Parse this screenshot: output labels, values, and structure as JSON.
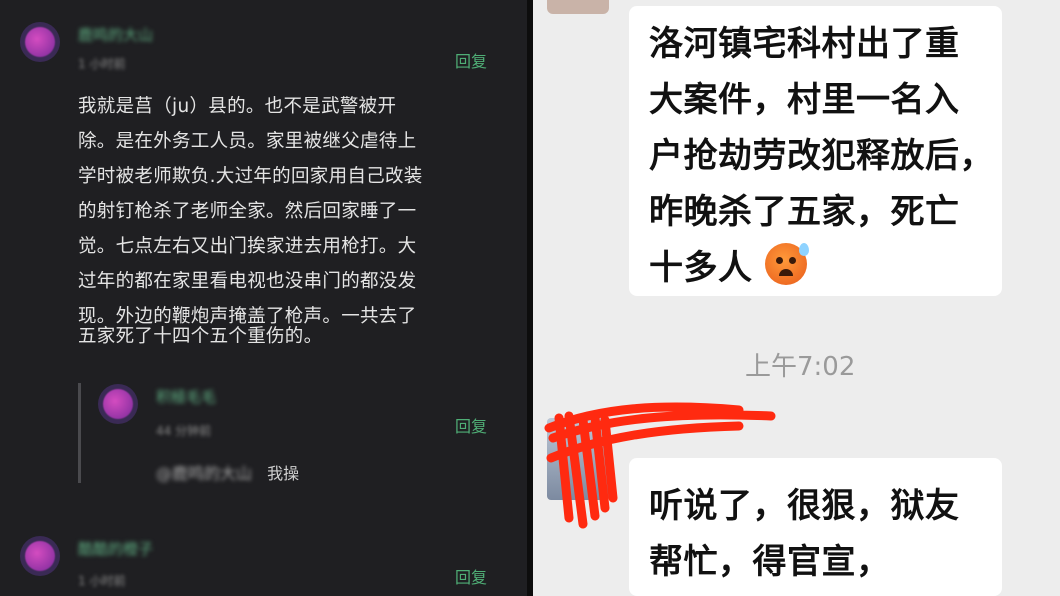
{
  "left": {
    "comments": [
      {
        "username": "鹿鸣的大山",
        "time": "1 小时前",
        "reply_label": "回复",
        "body_lines": [
          "我就是莒（ju）县的。也不是武警被开",
          "除。是在外务工人员。家里被继父虐待上",
          "学时被老师欺负.大过年的回家用自己改装",
          "的射钉枪杀了老师全家。然后回家睡了一",
          "觉。七点左右又出门挨家进去用枪打。大",
          "过年的都在家里看电视也没串门的都没发",
          "现。外边的鞭炮声掩盖了枪声。一共去了",
          "五家死了十四个五个重伤的。"
        ]
      },
      {
        "username": "积極毛毛",
        "time": "44 分钟前",
        "reply_label": "回复",
        "mention": "@鹿鸣的大山",
        "text": "我操"
      },
      {
        "username": "酷酷的橙子",
        "time": "1 小时前",
        "reply_label": "回复"
      }
    ]
  },
  "right": {
    "bubble1_lines": [
      "洛河镇宅科村出了重",
      "大案件，村里一名入",
      "户抢劫劳改犯释放后，",
      "昨晚杀了五家，死亡",
      "十多人"
    ],
    "timestamp": "上午7:02",
    "bubble2_lines": [
      "听说了，很狠，狱友",
      "帮忙，得官宣，"
    ]
  }
}
